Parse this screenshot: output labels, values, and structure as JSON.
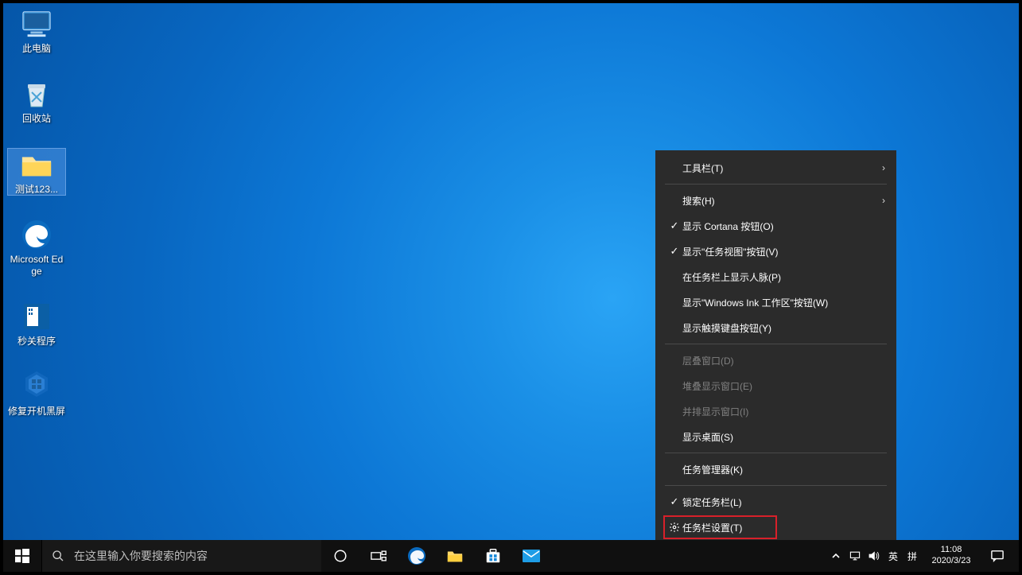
{
  "desktop": {
    "icons": [
      {
        "name": "此电脑",
        "type": "pc"
      },
      {
        "name": "回收站",
        "type": "recycle"
      },
      {
        "name": "测试123...",
        "type": "folder",
        "selected": true
      },
      {
        "name": "Microsoft Edge",
        "type": "edge"
      },
      {
        "name": "秒关程序",
        "type": "app-blue"
      },
      {
        "name": "修复开机黑屏",
        "type": "app-cube"
      }
    ]
  },
  "context_menu": {
    "items": [
      {
        "label": "工具栏(T)",
        "submenu": true
      },
      {
        "sep": true
      },
      {
        "label": "搜索(H)",
        "submenu": true
      },
      {
        "label": "显示 Cortana 按钮(O)",
        "checked": true
      },
      {
        "label": "显示\"任务视图\"按钮(V)",
        "checked": true
      },
      {
        "label": "在任务栏上显示人脉(P)"
      },
      {
        "label": "显示\"Windows Ink 工作区\"按钮(W)"
      },
      {
        "label": "显示触摸键盘按钮(Y)"
      },
      {
        "sep": true
      },
      {
        "label": "层叠窗口(D)",
        "disabled": true
      },
      {
        "label": "堆叠显示窗口(E)",
        "disabled": true
      },
      {
        "label": "并排显示窗口(I)",
        "disabled": true
      },
      {
        "label": "显示桌面(S)"
      },
      {
        "sep": true
      },
      {
        "label": "任务管理器(K)"
      },
      {
        "sep": true
      },
      {
        "label": "锁定任务栏(L)",
        "checked": true
      },
      {
        "label": "任务栏设置(T)",
        "gear": true,
        "highlight": true
      }
    ]
  },
  "taskbar": {
    "search_placeholder": "在这里输入你要搜索的内容",
    "search_value": "",
    "pinned": [
      "cortana",
      "taskview",
      "edge",
      "explorer",
      "store",
      "mail"
    ],
    "tray": {
      "ime1": "英",
      "ime2": "拼"
    },
    "clock": {
      "time": "11:08",
      "date": "2020/3/23"
    }
  }
}
